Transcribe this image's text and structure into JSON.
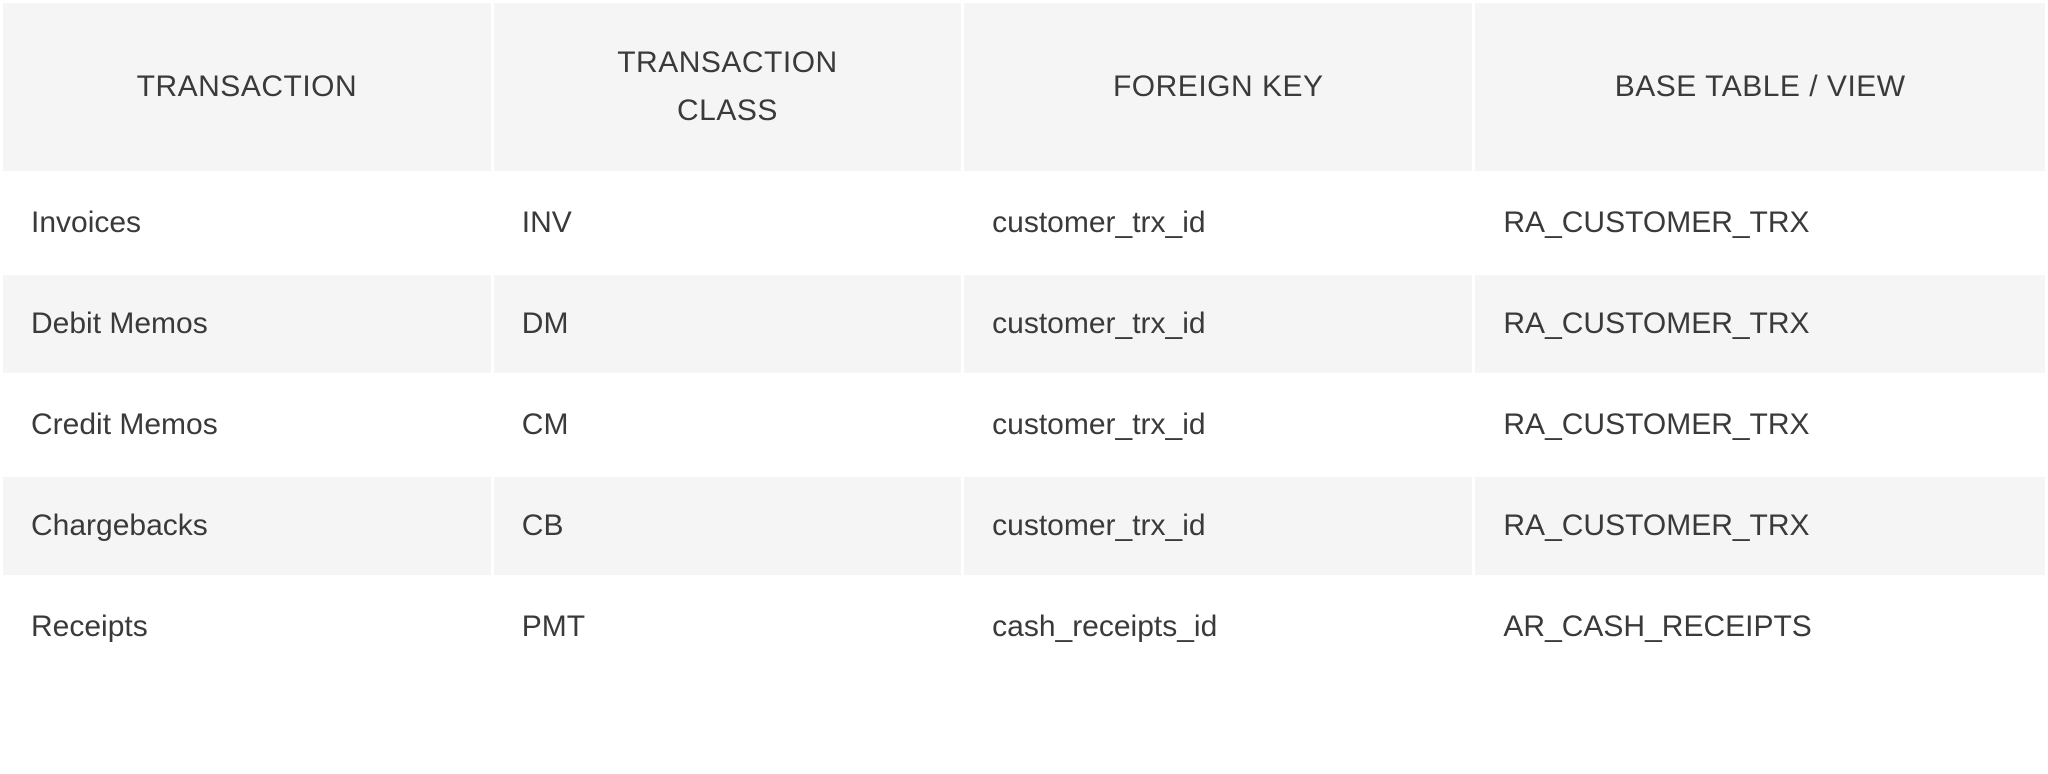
{
  "table": {
    "headers": {
      "transaction": "TRANSACTION",
      "transaction_class_line1": "TRANSACTION",
      "transaction_class_line2": "CLASS",
      "foreign_key": "FOREIGN KEY",
      "base_table_view": "BASE TABLE / VIEW"
    },
    "rows": [
      {
        "transaction": "Invoices",
        "class": "INV",
        "foreign_key": "customer_trx_id",
        "base_table": "RA_CUSTOMER_TRX"
      },
      {
        "transaction": "Debit Memos",
        "class": "DM",
        "foreign_key": "customer_trx_id",
        "base_table": "RA_CUSTOMER_TRX"
      },
      {
        "transaction": "Credit Memos",
        "class": "CM",
        "foreign_key": "customer_trx_id",
        "base_table": "RA_CUSTOMER_TRX"
      },
      {
        "transaction": "Chargebacks",
        "class": "CB",
        "foreign_key": "customer_trx_id",
        "base_table": "RA_CUSTOMER_TRX"
      },
      {
        "transaction": "Receipts",
        "class": "PMT",
        "foreign_key": "cash_receipts_id",
        "base_table": "AR_CASH_RECEIPTS"
      }
    ]
  }
}
